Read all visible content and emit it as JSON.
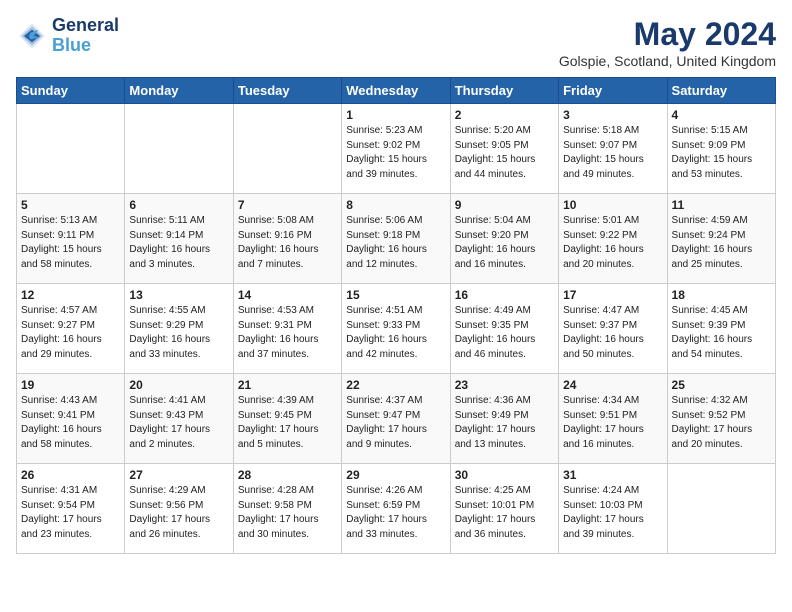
{
  "header": {
    "logo_line1": "General",
    "logo_line2": "Blue",
    "month_title": "May 2024",
    "subtitle": "Golspie, Scotland, United Kingdom"
  },
  "days_of_week": [
    "Sunday",
    "Monday",
    "Tuesday",
    "Wednesday",
    "Thursday",
    "Friday",
    "Saturday"
  ],
  "weeks": [
    [
      {
        "day": "",
        "info": ""
      },
      {
        "day": "",
        "info": ""
      },
      {
        "day": "",
        "info": ""
      },
      {
        "day": "1",
        "info": "Sunrise: 5:23 AM\nSunset: 9:02 PM\nDaylight: 15 hours\nand 39 minutes."
      },
      {
        "day": "2",
        "info": "Sunrise: 5:20 AM\nSunset: 9:05 PM\nDaylight: 15 hours\nand 44 minutes."
      },
      {
        "day": "3",
        "info": "Sunrise: 5:18 AM\nSunset: 9:07 PM\nDaylight: 15 hours\nand 49 minutes."
      },
      {
        "day": "4",
        "info": "Sunrise: 5:15 AM\nSunset: 9:09 PM\nDaylight: 15 hours\nand 53 minutes."
      }
    ],
    [
      {
        "day": "5",
        "info": "Sunrise: 5:13 AM\nSunset: 9:11 PM\nDaylight: 15 hours\nand 58 minutes."
      },
      {
        "day": "6",
        "info": "Sunrise: 5:11 AM\nSunset: 9:14 PM\nDaylight: 16 hours\nand 3 minutes."
      },
      {
        "day": "7",
        "info": "Sunrise: 5:08 AM\nSunset: 9:16 PM\nDaylight: 16 hours\nand 7 minutes."
      },
      {
        "day": "8",
        "info": "Sunrise: 5:06 AM\nSunset: 9:18 PM\nDaylight: 16 hours\nand 12 minutes."
      },
      {
        "day": "9",
        "info": "Sunrise: 5:04 AM\nSunset: 9:20 PM\nDaylight: 16 hours\nand 16 minutes."
      },
      {
        "day": "10",
        "info": "Sunrise: 5:01 AM\nSunset: 9:22 PM\nDaylight: 16 hours\nand 20 minutes."
      },
      {
        "day": "11",
        "info": "Sunrise: 4:59 AM\nSunset: 9:24 PM\nDaylight: 16 hours\nand 25 minutes."
      }
    ],
    [
      {
        "day": "12",
        "info": "Sunrise: 4:57 AM\nSunset: 9:27 PM\nDaylight: 16 hours\nand 29 minutes."
      },
      {
        "day": "13",
        "info": "Sunrise: 4:55 AM\nSunset: 9:29 PM\nDaylight: 16 hours\nand 33 minutes."
      },
      {
        "day": "14",
        "info": "Sunrise: 4:53 AM\nSunset: 9:31 PM\nDaylight: 16 hours\nand 37 minutes."
      },
      {
        "day": "15",
        "info": "Sunrise: 4:51 AM\nSunset: 9:33 PM\nDaylight: 16 hours\nand 42 minutes."
      },
      {
        "day": "16",
        "info": "Sunrise: 4:49 AM\nSunset: 9:35 PM\nDaylight: 16 hours\nand 46 minutes."
      },
      {
        "day": "17",
        "info": "Sunrise: 4:47 AM\nSunset: 9:37 PM\nDaylight: 16 hours\nand 50 minutes."
      },
      {
        "day": "18",
        "info": "Sunrise: 4:45 AM\nSunset: 9:39 PM\nDaylight: 16 hours\nand 54 minutes."
      }
    ],
    [
      {
        "day": "19",
        "info": "Sunrise: 4:43 AM\nSunset: 9:41 PM\nDaylight: 16 hours\nand 58 minutes."
      },
      {
        "day": "20",
        "info": "Sunrise: 4:41 AM\nSunset: 9:43 PM\nDaylight: 17 hours\nand 2 minutes."
      },
      {
        "day": "21",
        "info": "Sunrise: 4:39 AM\nSunset: 9:45 PM\nDaylight: 17 hours\nand 5 minutes."
      },
      {
        "day": "22",
        "info": "Sunrise: 4:37 AM\nSunset: 9:47 PM\nDaylight: 17 hours\nand 9 minutes."
      },
      {
        "day": "23",
        "info": "Sunrise: 4:36 AM\nSunset: 9:49 PM\nDaylight: 17 hours\nand 13 minutes."
      },
      {
        "day": "24",
        "info": "Sunrise: 4:34 AM\nSunset: 9:51 PM\nDaylight: 17 hours\nand 16 minutes."
      },
      {
        "day": "25",
        "info": "Sunrise: 4:32 AM\nSunset: 9:52 PM\nDaylight: 17 hours\nand 20 minutes."
      }
    ],
    [
      {
        "day": "26",
        "info": "Sunrise: 4:31 AM\nSunset: 9:54 PM\nDaylight: 17 hours\nand 23 minutes."
      },
      {
        "day": "27",
        "info": "Sunrise: 4:29 AM\nSunset: 9:56 PM\nDaylight: 17 hours\nand 26 minutes."
      },
      {
        "day": "28",
        "info": "Sunrise: 4:28 AM\nSunset: 9:58 PM\nDaylight: 17 hours\nand 30 minutes."
      },
      {
        "day": "29",
        "info": "Sunrise: 4:26 AM\nSunset: 6:59 PM\nDaylight: 17 hours\nand 33 minutes."
      },
      {
        "day": "30",
        "info": "Sunrise: 4:25 AM\nSunset: 10:01 PM\nDaylight: 17 hours\nand 36 minutes."
      },
      {
        "day": "31",
        "info": "Sunrise: 4:24 AM\nSunset: 10:03 PM\nDaylight: 17 hours\nand 39 minutes."
      },
      {
        "day": "",
        "info": ""
      }
    ]
  ]
}
